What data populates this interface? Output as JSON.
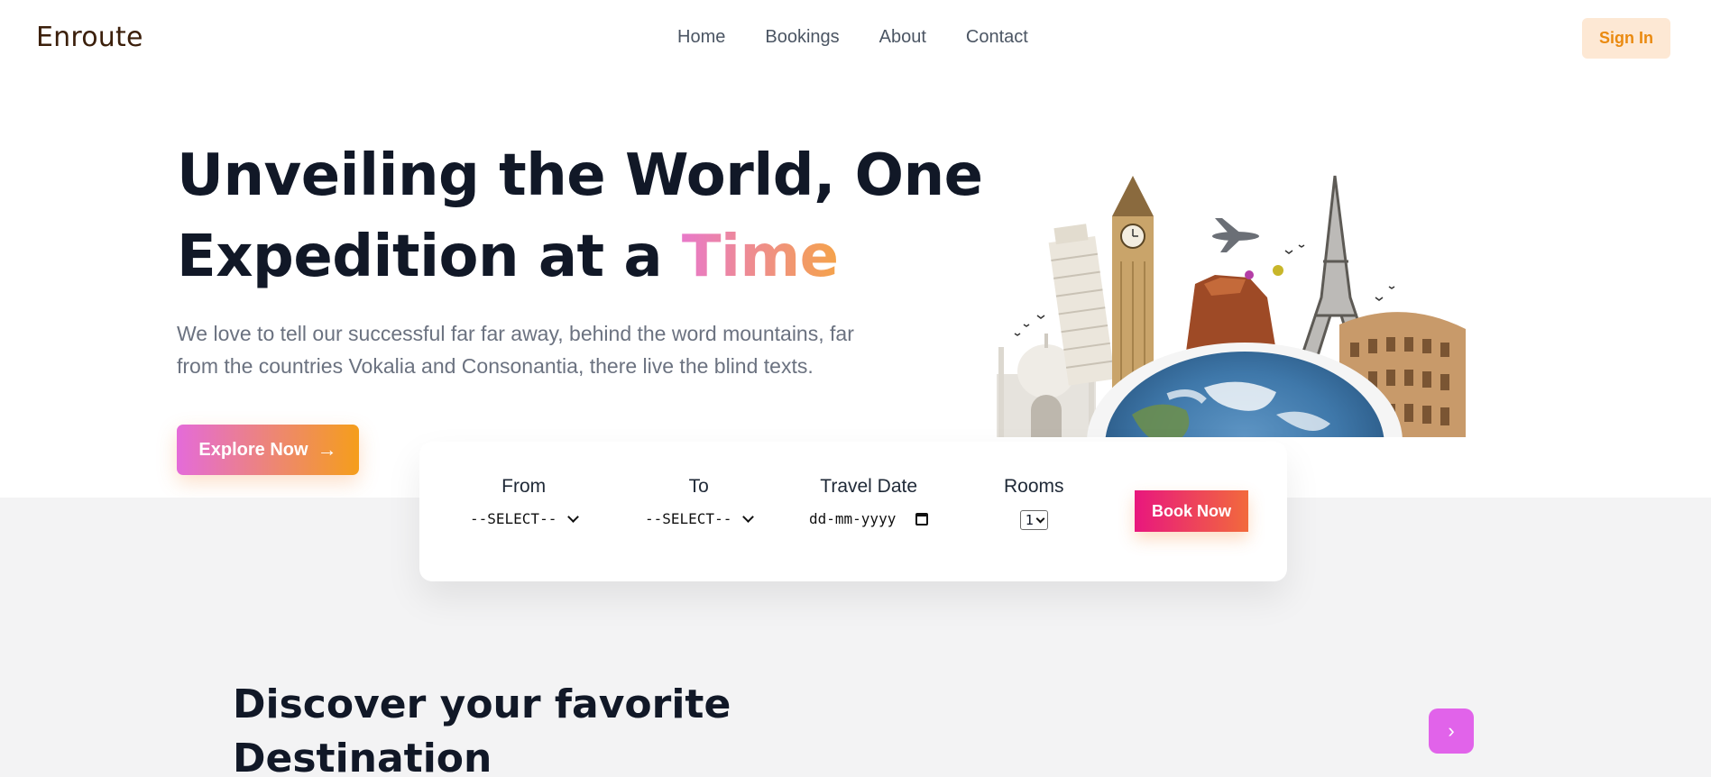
{
  "brand": {
    "logo": "Enroute"
  },
  "nav": {
    "items": [
      "Home",
      "Bookings",
      "About",
      "Contact"
    ]
  },
  "header": {
    "signin_label": "Sign In"
  },
  "hero": {
    "title_line1": "Unveiling the World, One",
    "title_line2_prefix": "Expedition at a ",
    "title_accent": "Time",
    "description_line1": "We love to tell our successful far far away, behind the word mountains, far",
    "description_line2": "from the countries Vokalia and Consonantia, there live the blind texts.",
    "cta_label": "Explore Now",
    "cta_icon": "arrow-right-icon"
  },
  "booking": {
    "from_label": "From",
    "from_value": "--SELECT--",
    "to_label": "To",
    "to_value": "--SELECT--",
    "date_label": "Travel Date",
    "date_placeholder": "dd-mm-yyyy",
    "rooms_label": "Rooms",
    "rooms_value": "1",
    "submit_label": "Book Now"
  },
  "discover": {
    "title_line1": "Discover your favorite",
    "title_line2": "Destination",
    "next_icon": "chevron-right-icon"
  },
  "colors": {
    "accent_gradient_start": "#e46bd9",
    "accent_gradient_end": "#f59e1b",
    "signin_bg": "#fde8d4",
    "signin_text": "#ea8a10",
    "book_gradient_start": "#e8177e",
    "book_gradient_end": "#f26a3c",
    "next_button": "#e163ea",
    "section_bg": "#f3f3f4"
  }
}
